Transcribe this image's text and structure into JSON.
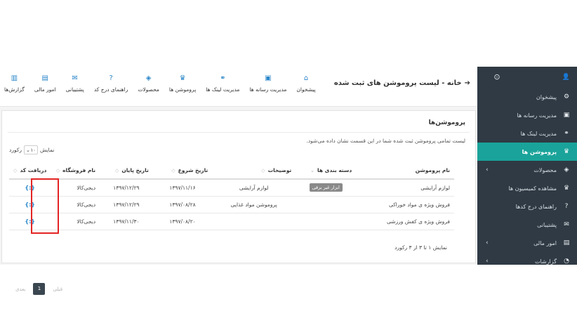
{
  "sidebar": {
    "items": [
      {
        "label": "پیشخوان",
        "icon": "dashboard-icon",
        "glyph": "⚙",
        "chevron": false
      },
      {
        "label": "مدیریت رسانه ها",
        "icon": "media-icon",
        "glyph": "▣",
        "chevron": false
      },
      {
        "label": "مدیریت لینک ها",
        "icon": "link-icon",
        "glyph": "⚭",
        "chevron": false
      },
      {
        "label": "پروموشن ها",
        "icon": "trophy-icon",
        "glyph": "♛",
        "chevron": false,
        "active": true
      },
      {
        "label": "محصولات",
        "icon": "tag-icon",
        "glyph": "◈",
        "chevron": true
      },
      {
        "label": "مشاهده کمیسیون ها",
        "icon": "commission-icon",
        "glyph": "♛",
        "chevron": false
      },
      {
        "label": "راهنمای درج کدها",
        "icon": "help-icon",
        "glyph": "?",
        "chevron": false
      },
      {
        "label": "پشتیبانی",
        "icon": "support-icon",
        "glyph": "✉",
        "chevron": false
      },
      {
        "label": "امور مالی",
        "icon": "finance-icon",
        "glyph": "▤",
        "chevron": true
      },
      {
        "label": "گزارشات",
        "icon": "report-icon",
        "glyph": "◔",
        "chevron": true
      }
    ]
  },
  "header": {
    "breadcrumb": "خانه - لیست پروموشن های ثبت شده",
    "quick_links": [
      {
        "label": "گزارش‌ها",
        "icon": "chart-icon",
        "glyph": "▥"
      },
      {
        "label": "امور مالی",
        "icon": "finance-icon",
        "glyph": "▤"
      },
      {
        "label": "پشتیبانی",
        "icon": "support-icon",
        "glyph": "✉"
      },
      {
        "label": "راهنمای درج کد",
        "icon": "help-icon",
        "glyph": "?"
      },
      {
        "label": "محصولات",
        "icon": "tag-icon",
        "glyph": "◈"
      },
      {
        "label": "پروموشن ها",
        "icon": "trophy-icon",
        "glyph": "♛"
      },
      {
        "label": "مدیریت لینک ها",
        "icon": "link-icon",
        "glyph": "⚭"
      },
      {
        "label": "مدیریت رسانه ها",
        "icon": "media-icon",
        "glyph": "▣"
      },
      {
        "label": "پیشخوان",
        "icon": "home-icon",
        "glyph": "⌂"
      }
    ]
  },
  "panel": {
    "title": "پروموشن‌ها",
    "description": "لیست تمامی پروموشن ثبت شده شما در این قسمت نشان داده می‌شود.",
    "length_prefix": "نمایش",
    "length_value": "۱۰",
    "length_suffix": "رکورد"
  },
  "table": {
    "headers": [
      "نام پروموشن",
      "دسته بندی ها",
      "توضیحات",
      "تاریخ شروع",
      "تاریخ پایان",
      "نام فروشگاه",
      "دریافت کد"
    ],
    "rows": [
      {
        "name": "لوازم آرایشی",
        "category": "ابزار غیر برقی",
        "desc": "لوازم آرایشی",
        "start": "۱۳۹۷/۱۱/۱۶",
        "end": "۱۳۹۷/۱۲/۲۹",
        "store": "دیجی‌کالا",
        "code": "{:}"
      },
      {
        "name": "فروش ویژه ی مواد خوراکی",
        "category": "",
        "desc": "پروموشن مواد غذایی",
        "start": "۱۳۹۷/۰۸/۲۸",
        "end": "۱۳۹۷/۱۲/۲۹",
        "store": "دیجی‌کالا",
        "code": "{:}"
      },
      {
        "name": "فروش ویژه ی کفش ورزشی",
        "category": "",
        "desc": "",
        "start": "۱۳۹۷/۰۸/۲۰",
        "end": "۱۳۹۷/۱۱/۳۰",
        "store": "دیجی‌کالا",
        "code": "{:}"
      }
    ]
  },
  "footer": {
    "info": "نمایش ۱ تا ۳ از ۳ رکورد",
    "prev": "قبلی",
    "next": "بعدی",
    "current_page": "1"
  },
  "colors": {
    "sidebar_bg": "#2f3a44",
    "active": "#1aa39a",
    "accent": "#2a86c9",
    "highlight": "#e32424"
  }
}
